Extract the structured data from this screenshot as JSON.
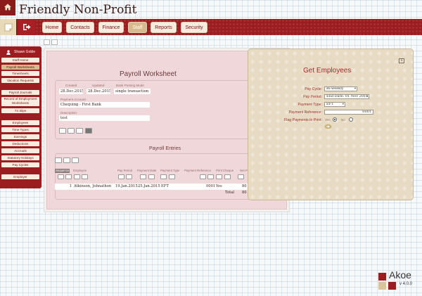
{
  "app": {
    "title": "Friendly Non-Profit"
  },
  "nav": {
    "items": [
      {
        "label": "Home"
      },
      {
        "label": "Contacts"
      },
      {
        "label": "Finance"
      },
      {
        "label": "Staff"
      },
      {
        "label": "Reports"
      },
      {
        "label": "Security"
      }
    ],
    "active": "Staff"
  },
  "user": {
    "name": "Shawn Goble"
  },
  "sidebar": {
    "items": [
      {
        "label": "Staff Home"
      },
      {
        "label": "Payroll Worksheets"
      },
      {
        "label": "Timesheets"
      },
      {
        "label": "Vacation Requests"
      },
      {
        "label": "Payroll Journals"
      },
      {
        "label": "Record of Employment Worksheets"
      },
      {
        "label": "T4 Slips"
      },
      {
        "label": "Employees"
      },
      {
        "label": "Time Types"
      },
      {
        "label": "Earnings"
      },
      {
        "label": "Deductions"
      },
      {
        "label": "Accruals"
      },
      {
        "label": "Statutory Holidays"
      },
      {
        "label": "Pay Cycles"
      },
      {
        "label": "Employer"
      }
    ],
    "active": "Payroll Worksheets"
  },
  "worksheet": {
    "title": "Payroll Worksheet",
    "created_label": "Created",
    "created": "28.Dec.2015",
    "updated_label": "Updated",
    "updated": "28.Dec.2015",
    "bank_mode_label": "Bank Posting Mode",
    "bank_mode": "single transaction",
    "payment_account_label": "Payment Account",
    "payment_account": "Chequing - First Bank",
    "description_label": "Description",
    "description": "test"
  },
  "entries": {
    "title": "Payroll Entries",
    "columns": [
      "Sequence",
      "Employee",
      "Pay Period",
      "Payment Date",
      "Payment Type",
      "Payment Reference",
      "Print Cheque",
      "Net P"
    ],
    "rows": [
      {
        "sequence": "1",
        "employee": "Atkinson, Johnathon",
        "pay_period": "19.Jan.2015",
        "payment_date": "25.Jan.2015",
        "payment_type": "EFT",
        "payment_reference": "0001",
        "print_cheque": "Yes",
        "net_pay": "80"
      }
    ],
    "total_label": "Total",
    "total_value": "80"
  },
  "dialog": {
    "title": "Get Employees",
    "close_label": "x",
    "pay_cycle_label": "Pay Cycle:",
    "pay_cycle": "Bi-weekly",
    "pay_period_label": "Pay Period:",
    "pay_period": "End Date: 01 Nov 2015",
    "payment_type_label": "Payment Type:",
    "payment_type": "EFT",
    "payment_reference_label": "Payment Reference:",
    "payment_reference": "0001",
    "flag_label": "Flag Payments to Print:",
    "yes_label": "Yes",
    "no_label": "No",
    "flag_selected": "Yes"
  },
  "brand": {
    "name": "Akoe",
    "version": "v 4.0.0"
  },
  "colors": {
    "brand_red": "#9b1d20",
    "tan": "#d9b98e",
    "dialog_bg": "#e7dcc3"
  },
  "icons": [
    "home-icon",
    "note-icon",
    "logout-icon",
    "user-icon",
    "close-icon",
    "go-icon"
  ]
}
